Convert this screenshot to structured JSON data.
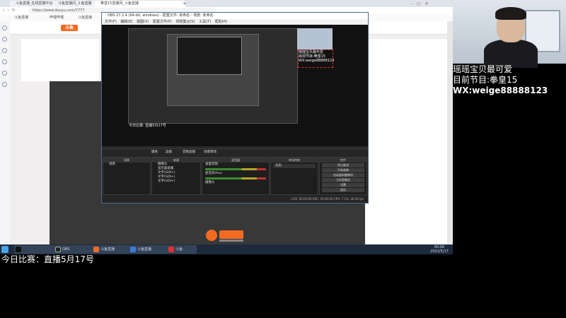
{
  "browser": {
    "tabs": [
      {
        "label": "斗鱼直播_在线直播平台_斗鱼直播",
        "active": false
      },
      {
        "label": "斗鱼直播间_斗鱼直播",
        "active": false
      },
      {
        "label": "拳皇15直播间_斗鱼直播",
        "active": true
      }
    ],
    "url": "https://www.douyu.com/7777",
    "bookmarks": [
      "斗鱼直播",
      "哔哩哔哩",
      "斗鱼直播",
      "斗鱼直播"
    ],
    "site_logo": "斗鱼"
  },
  "obs": {
    "title": "OBS 27.2.4 (64-bit, windows) - 配置文件: 未命名 - 场景: 未命名",
    "menu": [
      "文件(F)",
      "编辑(E)",
      "视图(V)",
      "配置文件(P)",
      "场景集合(S)",
      "工具(T)",
      "帮助(H)"
    ],
    "overlay_lines": [
      "瑶瑶宝贝最可爱",
      "目前节目:拳皇15",
      "WX:weige88888123"
    ],
    "preview_caption": "今日比赛: 直播5月17号",
    "strip_tabs": [
      "属性",
      "滤镜",
      "音频滤镜",
      "场景转场"
    ],
    "docks": {
      "scenes": {
        "title": "场景",
        "items": [
          "场景"
        ]
      },
      "sources": {
        "title": "来源",
        "items": [
          "摄像头",
          "显示器采集",
          "文字(GDI+)",
          "文字(GDI+)",
          "文字(GDI+)"
        ]
      },
      "mixer": {
        "title": "混音器",
        "channels": [
          "桌面音频",
          "麦克风/Aux",
          "摄像头"
        ]
      },
      "transitions": {
        "title": "转场特效",
        "value": "淡出"
      },
      "controls": {
        "title": "控件",
        "buttons": [
          "停止推流",
          "开始录制",
          "启动虚拟摄像机",
          "工作室模式",
          "设置",
          "退出"
        ]
      }
    },
    "status": "LIVE: 00:00:00   REC: 00:00:00   CPU: 7.1%, 30.00 fps"
  },
  "taskbar": {
    "items": [
      "",
      "",
      "OBS",
      "斗鱼直播",
      "斗鱼直播",
      "斗鱼"
    ],
    "clock_time": "00:00",
    "clock_date": "2022/5/17"
  },
  "stream_overlay": {
    "line1": "瑶瑶宝贝最可爱",
    "line2": "目前节目:拳皇15",
    "line3": "WX:weige88888123",
    "bottom": "今日比赛：直播5月17号"
  },
  "colors": {
    "douyu_orange": "#f36b21",
    "obs_dark": "#2b2b2b",
    "taskbar": "#1d2a3a"
  }
}
